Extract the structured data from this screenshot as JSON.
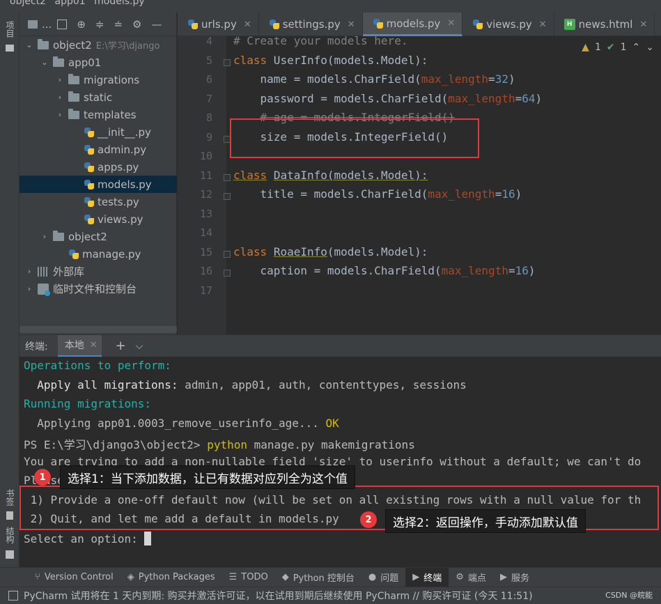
{
  "breadcrumb": [
    "object2",
    "app01",
    "models.py"
  ],
  "left_strip": {
    "project_label": "项目",
    "bookmarks_label": "书签",
    "structure_label": "结构"
  },
  "project_toolbar": {
    "title": "..."
  },
  "tree": [
    {
      "label": "object2",
      "extra": "E:\\学习\\django",
      "type": "folder",
      "depth": 0,
      "expanded": true
    },
    {
      "label": "app01",
      "type": "folder",
      "depth": 1,
      "expanded": true
    },
    {
      "label": "migrations",
      "type": "folder",
      "depth": 2,
      "expanded": false
    },
    {
      "label": "static",
      "type": "folder",
      "depth": 2,
      "expanded": false
    },
    {
      "label": "templates",
      "type": "folder",
      "depth": 2,
      "expanded": false
    },
    {
      "label": "__init__.py",
      "type": "py",
      "depth": 3
    },
    {
      "label": "admin.py",
      "type": "py",
      "depth": 3
    },
    {
      "label": "apps.py",
      "type": "py",
      "depth": 3
    },
    {
      "label": "models.py",
      "type": "py",
      "depth": 3,
      "selected": true
    },
    {
      "label": "tests.py",
      "type": "py",
      "depth": 3
    },
    {
      "label": "views.py",
      "type": "py",
      "depth": 3
    },
    {
      "label": "object2",
      "type": "folder",
      "depth": 1,
      "expanded": false
    },
    {
      "label": "manage.py",
      "type": "py",
      "depth": 2
    },
    {
      "label": "外部库",
      "type": "lib",
      "depth": 0,
      "expanded": false
    },
    {
      "label": "临时文件和控制台",
      "type": "scratch",
      "depth": 0,
      "expanded": false
    }
  ],
  "tabs": [
    {
      "label": "urls.py",
      "type": "py",
      "active": false
    },
    {
      "label": "settings.py",
      "type": "py",
      "active": false
    },
    {
      "label": "models.py",
      "type": "py",
      "active": true
    },
    {
      "label": "views.py",
      "type": "py",
      "active": false
    },
    {
      "label": "news.html",
      "type": "html",
      "active": false
    }
  ],
  "inspections": {
    "warnings": "1",
    "weak_warnings": "1"
  },
  "code": [
    {
      "ln": "4",
      "html": "<span class=\"comment\"># Create your models here.</span>"
    },
    {
      "ln": "5",
      "html": "<span class=\"kw\">class</span> UserInfo(models.Model):"
    },
    {
      "ln": "6",
      "html": "    name = models.CharField(<span class=\"kwarg\">max_length</span>=<span class=\"num\">32</span>)"
    },
    {
      "ln": "7",
      "html": "    password = models.CharField(<span class=\"kwarg\">max_length</span>=<span class=\"num\">64</span>)"
    },
    {
      "ln": "8",
      "html": "    <span class=\"strike\"># age = models.IntegerField()</span>"
    },
    {
      "ln": "9",
      "html": "    size = models.IntegerField()"
    },
    {
      "ln": "10",
      "html": ""
    },
    {
      "ln": "11",
      "html": "<span class=\"kw\" style=\"text-decoration:underline;text-decoration-color:#8a8a2a\">class</span> <span class=\"cls-name\">DataInfo(models.Model):</span>"
    },
    {
      "ln": "12",
      "html": "    title = models.CharField(<span class=\"kwarg\">max_length</span>=<span class=\"num\">16</span>)"
    },
    {
      "ln": "13",
      "html": ""
    },
    {
      "ln": "14",
      "html": ""
    },
    {
      "ln": "15",
      "html": "<span class=\"kw\">class</span> <span class=\"cls-name\">RoaeInfo</span>(models.Model):"
    },
    {
      "ln": "16",
      "html": "    caption = models.CharField(<span class=\"kwarg\">max_length</span>=<span class=\"num\">16</span>)"
    },
    {
      "ln": "17",
      "html": ""
    }
  ],
  "terminal_header": {
    "label": "终端:",
    "tab": "本地"
  },
  "terminal_lines": [
    "<span class=\"cyan\">Operations to perform:</span>",
    "  <span class=\"white\">Apply all migrations:</span> admin, app01, auth, contenttypes, sessions",
    "<span class=\"cyan\">Running migrations:</span>",
    "  Applying app01.0003_remove_userinfo_age... <span class=\"yellow\">OK</span>",
    "PS E:\\学习\\django3\\object2> <span class=\"yellow\">python</span> manage.py makemigrations",
    "You are trying to add a non-nullable field 'size' to userinfo without a default; we can't do",
    "Please select a fix:",
    " 1) Provide a one-off default now (will be set on all existing rows with a null value for th",
    " 2) Quit, and let me add a default in models.py",
    "Select an option: "
  ],
  "callouts": [
    {
      "badge": "1",
      "text": "选择1：当下添加数据，让已有数据对应列全为这个值"
    },
    {
      "badge": "2",
      "text": "选择2：返回操作，手动添加默认值"
    }
  ],
  "tool_windows": [
    {
      "label": "Version Control",
      "icon": "⑂",
      "active": false
    },
    {
      "label": "Python Packages",
      "icon": "◈",
      "active": false
    },
    {
      "label": "TODO",
      "icon": "☰",
      "active": false
    },
    {
      "label": "Python 控制台",
      "icon": "◆",
      "active": false
    },
    {
      "label": "问题",
      "icon": "●",
      "active": false
    },
    {
      "label": "终端",
      "icon": "▶",
      "active": true
    },
    {
      "label": "端点",
      "icon": "⚙",
      "active": false
    },
    {
      "label": "服务",
      "icon": "▶",
      "active": false
    }
  ],
  "status": {
    "message": "PyCharm 试用将在 1 天内到期: 购买并激活许可证，以在试用到期后继续使用 PyCharm // 购买许可证 (今天 11:51)"
  },
  "watermark": "CSDN @皖能"
}
